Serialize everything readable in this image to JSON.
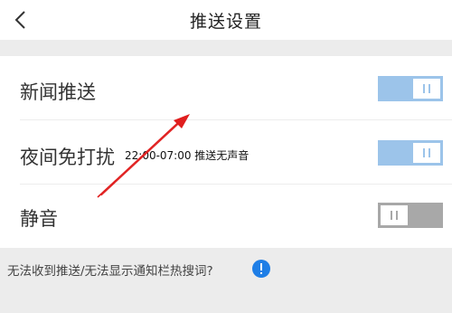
{
  "header": {
    "back_icon": "chevron-left-icon",
    "title": "推送设置"
  },
  "settings": [
    {
      "label": "新闻推送",
      "state": "on"
    },
    {
      "label": "夜间免打扰",
      "note": "22:00-07:00 推送无声音",
      "state": "on"
    },
    {
      "label": "静音",
      "state": "off"
    }
  ],
  "help": {
    "text": "无法收到推送/无法显示通知栏热搜词?",
    "icon": "info-icon"
  },
  "colors": {
    "toggle_on": "#9cc4ea",
    "toggle_off": "#a8a8a8",
    "info_blue": "#1e7ee6",
    "annotation_arrow": "#e01e1e"
  }
}
